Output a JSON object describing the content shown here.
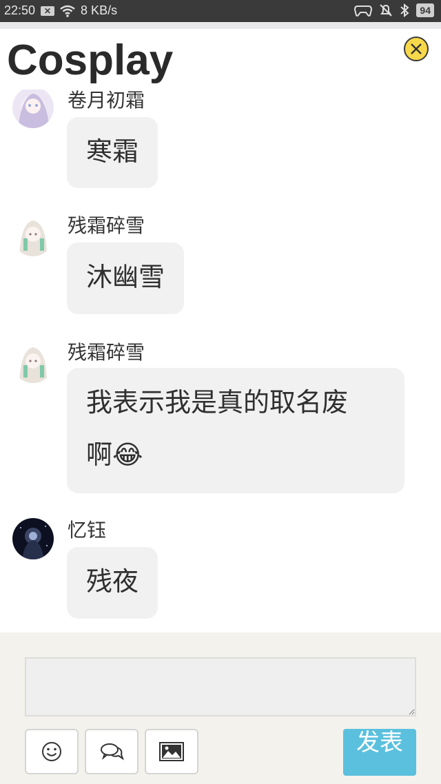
{
  "status_bar": {
    "time": "22:50",
    "network_speed": "8 KB/s",
    "battery": "94"
  },
  "header": {
    "title": "Cosplay",
    "close_icon": "close-icon"
  },
  "messages": [
    {
      "nickname": "卷月初霜",
      "text": "寒霜"
    },
    {
      "nickname": "残霜碎雪",
      "text": "沐幽雪"
    },
    {
      "nickname": "残霜碎雪",
      "text": "我表示我是真的取名废",
      "text2": "啊😂"
    },
    {
      "nickname": "忆钰",
      "text": "残夜"
    }
  ],
  "composer": {
    "input_value": "",
    "emoji_icon": "smiley-icon",
    "chat_icon": "chat-bubbles-icon",
    "image_icon": "image-icon",
    "send_label": "发表"
  },
  "colors": {
    "status_bar": "#3a3a3a",
    "bubble": "#f1f1f1",
    "send_button": "#5bc0de",
    "close_button": "#f7d84a",
    "composer_bg": "#f3f2ec"
  }
}
